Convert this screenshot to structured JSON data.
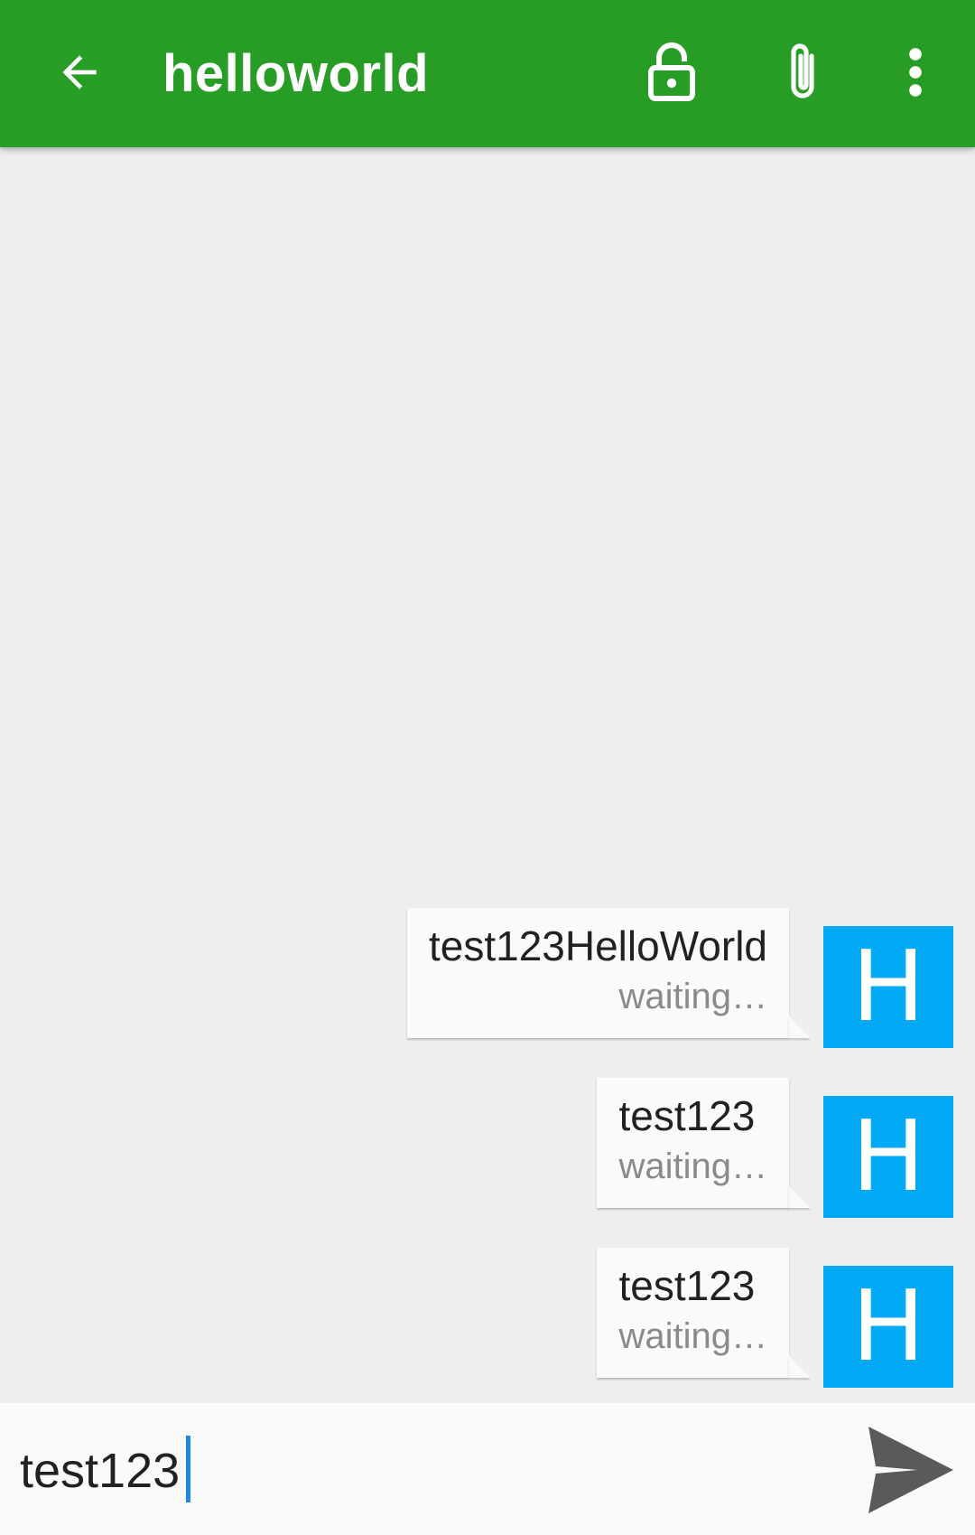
{
  "app_bar": {
    "title": "helloworld",
    "back_icon": "arrow-back-icon",
    "lock_icon": "lock-open-icon",
    "attach_icon": "paperclip-icon",
    "more_icon": "more-vert-icon",
    "color": "#279d25"
  },
  "messages": [
    {
      "text": "test123HelloWorld",
      "status": "waiting…",
      "avatar_letter": "H"
    },
    {
      "text": "test123",
      "status": "waiting…",
      "avatar_letter": "H"
    },
    {
      "text": "test123",
      "status": "waiting…",
      "avatar_letter": "H"
    }
  ],
  "avatar_color": "#03a9f4",
  "composer": {
    "value": "test123",
    "send_icon": "send-icon"
  }
}
